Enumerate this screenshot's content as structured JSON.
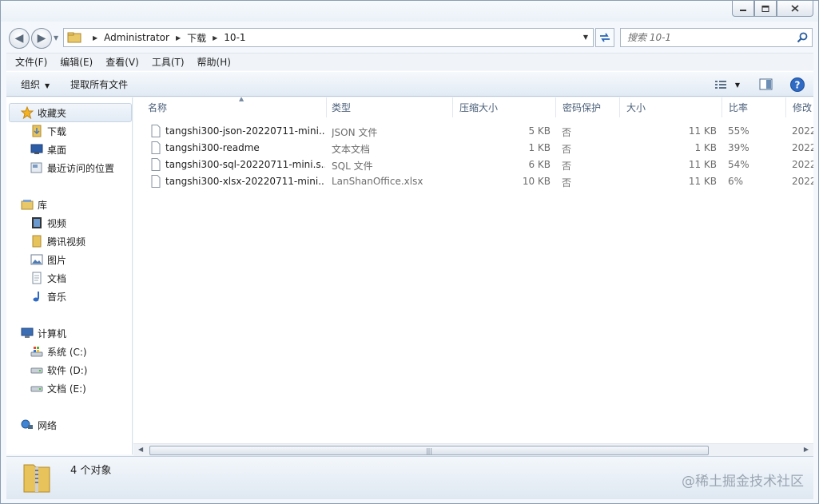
{
  "window": {
    "title": ""
  },
  "address": {
    "crumbs": [
      "Administrator",
      "下载",
      "10-1"
    ]
  },
  "search": {
    "placeholder": "搜索 10-1"
  },
  "menu": {
    "items": [
      "文件(F)",
      "编辑(E)",
      "查看(V)",
      "工具(T)",
      "帮助(H)"
    ]
  },
  "toolbar": {
    "organize": "组织",
    "extract_all": "提取所有文件"
  },
  "nav": {
    "favorites": "收藏夹",
    "downloads": "下载",
    "desktop": "桌面",
    "recent": "最近访问的位置",
    "libraries": "库",
    "videos": "视频",
    "tencent_video": "腾讯视频",
    "pictures": "图片",
    "documents": "文档",
    "music": "音乐",
    "computer": "计算机",
    "drive_c": "系统 (C:)",
    "drive_d": "软件 (D:)",
    "drive_e": "文档 (E:)",
    "network": "网络"
  },
  "columns": {
    "name": "名称",
    "type": "类型",
    "compressed_size": "压缩大小",
    "password": "密码保护",
    "size": "大小",
    "ratio": "比率",
    "modified": "修改"
  },
  "files": [
    {
      "name": "tangshi300-json-20220711-mini....",
      "type": "JSON 文件",
      "compressed": "5 KB",
      "password": "否",
      "size": "11 KB",
      "ratio": "55%",
      "modified": "2022"
    },
    {
      "name": "tangshi300-readme",
      "type": "文本文档",
      "compressed": "1 KB",
      "password": "否",
      "size": "1 KB",
      "ratio": "39%",
      "modified": "2022"
    },
    {
      "name": "tangshi300-sql-20220711-mini.s...",
      "type": "SQL 文件",
      "compressed": "6 KB",
      "password": "否",
      "size": "11 KB",
      "ratio": "54%",
      "modified": "2022"
    },
    {
      "name": "tangshi300-xlsx-20220711-mini....",
      "type": "LanShanOffice.xlsx",
      "compressed": "10 KB",
      "password": "否",
      "size": "11 KB",
      "ratio": "6%",
      "modified": "2022"
    }
  ],
  "status": {
    "count": "4 个对象"
  },
  "watermark": "@稀土掘金技术社区",
  "colors": {
    "accent": "#1e5fb4",
    "chrome": "#f4f8fc",
    "header_text": "#4c607a"
  }
}
